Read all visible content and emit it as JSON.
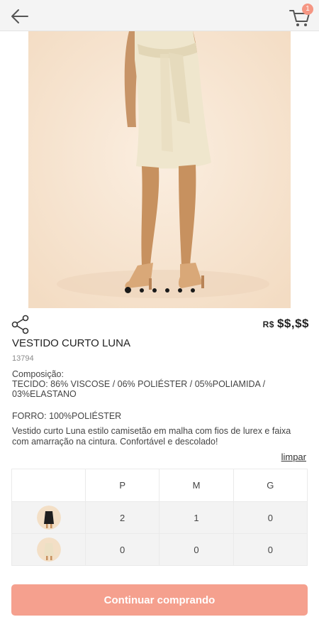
{
  "header": {
    "back_icon": "arrow-left-icon",
    "cart_icon": "shopping-cart-icon",
    "cart_count": "1"
  },
  "gallery": {
    "image": "product-photo",
    "slides": 6,
    "active_slide": 1
  },
  "product": {
    "currency": "R$",
    "price": "$$,$$",
    "name": "VESTIDO CURTO LUNA",
    "code": "13794",
    "composition_label": "Composição:",
    "composition_text": "TECIDO: 86% VISCOSE / 06% POLIÉSTER / 05%POLIAMIDA / 03%ELASTANO",
    "lining": "FORRO: 100%POLIÉSTER",
    "description": "Vestido curto Luna estilo camisetão em malha com fios de lurex e faixa com amarração na cintura. Confortável e descolado!"
  },
  "actions": {
    "share_icon": "share-icon",
    "clear_label": "limpar",
    "continue_label": "Continuar comprando"
  },
  "size_grid": {
    "sizes": [
      "P",
      "M",
      "G"
    ],
    "rows": [
      {
        "color": "preto",
        "swatch": "#1e1e1e",
        "quantities": [
          "2",
          "1",
          "0"
        ]
      },
      {
        "color": "bege",
        "swatch": "#e8d7bf",
        "quantities": [
          "0",
          "0",
          "0"
        ]
      }
    ]
  },
  "colors": {
    "accent": "#f5a08e",
    "badge": "#f59683",
    "photo_background": "#f7e8d6"
  }
}
